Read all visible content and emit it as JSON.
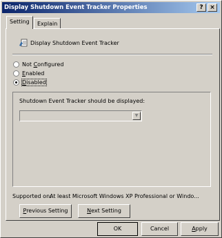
{
  "window": {
    "title": "Display Shutdown Event Tracker Properties",
    "help_button": "?",
    "close_button": "×"
  },
  "tabs": [
    {
      "label": "Setting"
    },
    {
      "label": "Explain"
    }
  ],
  "setting": {
    "name": "Display Shutdown Event Tracker",
    "icon": "policy-setting-icon",
    "options": [
      {
        "label": "Not Configured",
        "selected": false
      },
      {
        "label": "Enabled",
        "selected": false
      },
      {
        "label": "Disabled",
        "selected": true
      }
    ],
    "group_label": "Shutdown Event Tracker should be displayed:",
    "dropdown_value": "",
    "supported_label": "Supported on:",
    "supported_text": "At least Microsoft Windows XP Professional or Windo...",
    "previous_button": "Previous Setting",
    "next_button": "Next Setting"
  },
  "footer": {
    "ok": "OK",
    "cancel": "Cancel",
    "apply": "Apply"
  }
}
